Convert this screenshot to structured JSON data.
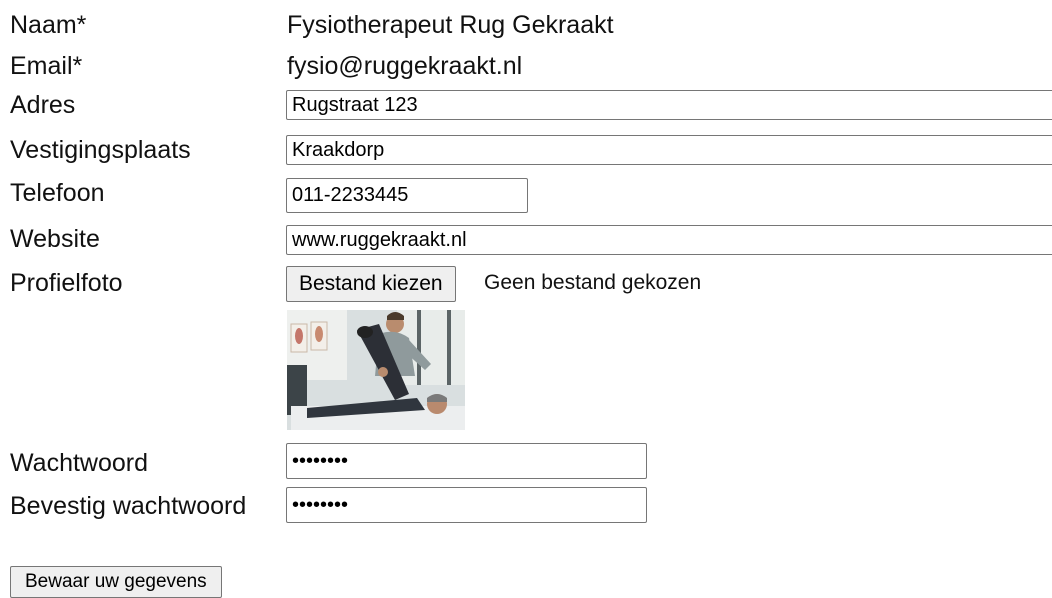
{
  "form": {
    "naam": {
      "label": "Naam*",
      "value": "Fysiotherapeut Rug Gekraakt"
    },
    "email": {
      "label": "Email*",
      "value": "fysio@ruggekraakt.nl"
    },
    "adres": {
      "label": "Adres",
      "value": "Rugstraat 123"
    },
    "vestigingsplaats": {
      "label": "Vestigingsplaats",
      "value": "Kraakdorp"
    },
    "telefoon": {
      "label": "Telefoon",
      "value": "011-2233445"
    },
    "website": {
      "label": "Website",
      "value": "www.ruggekraakt.nl"
    },
    "profielfoto": {
      "label": "Profielfoto",
      "button_label": "Bestand kiezen",
      "status": "Geen bestand gekozen"
    },
    "wachtwoord": {
      "label": "Wachtwoord",
      "value": "********"
    },
    "bevestig_wachtwoord": {
      "label": "Bevestig wachtwoord",
      "value": "********"
    },
    "save_label": "Bewaar uw gegevens"
  }
}
